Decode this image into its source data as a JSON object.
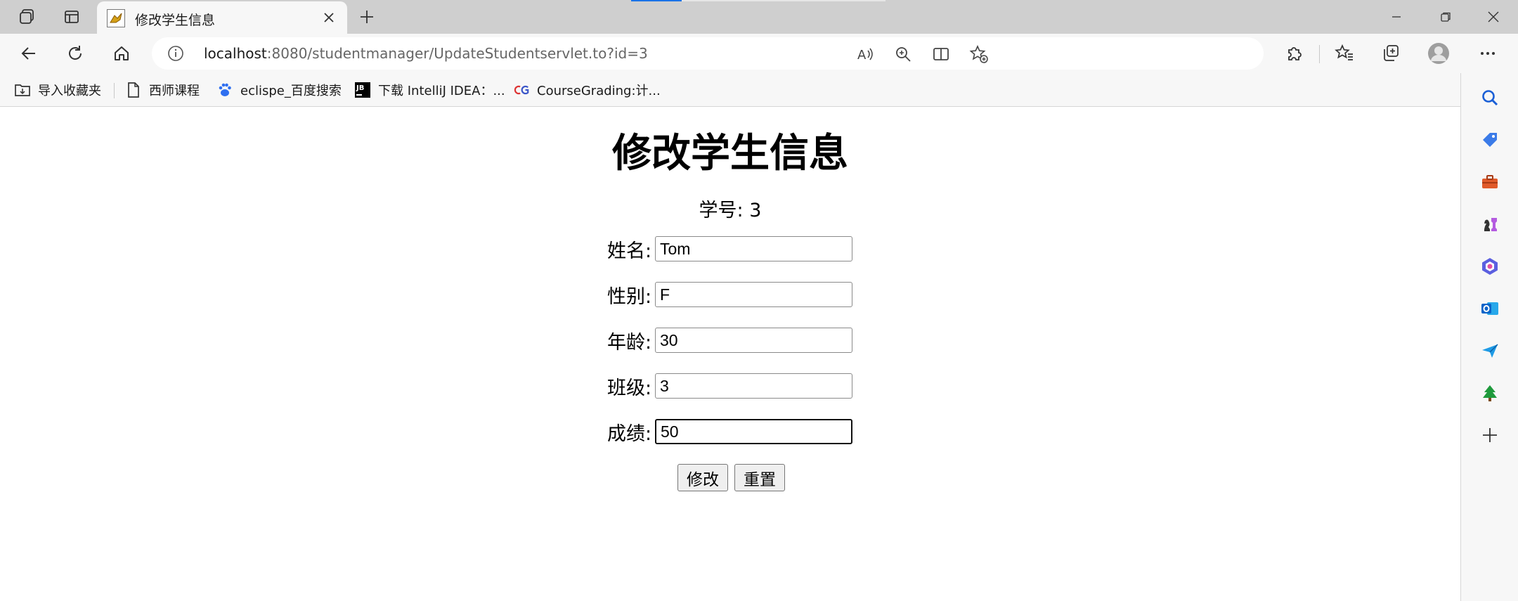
{
  "browser": {
    "tab_title": "修改学生信息",
    "url_host": "localhost",
    "url_rest": ":8080/studentmanager/UpdateStudentservlet.to?id=3",
    "bookmarks": [
      {
        "label": "导入收藏夹",
        "icon": "import-folder-icon"
      },
      {
        "label": "西师课程",
        "icon": "page-icon"
      },
      {
        "label": "eclispe_百度搜索",
        "icon": "baidu-paw-icon"
      },
      {
        "label": "下载 IntelliJ IDEA：...",
        "icon": "jetbrains-icon"
      },
      {
        "label": "CourseGrading:计...",
        "icon": "coursegrading-icon"
      }
    ],
    "sidebar_icons": [
      "search-icon",
      "tag-icon",
      "toolbox-icon",
      "chess-icon",
      "copilot-icon",
      "outlook-icon",
      "send-icon",
      "tree-icon",
      "add-icon"
    ],
    "accent": "#1a73e8"
  },
  "form": {
    "title": "修改学生信息",
    "student_id_label": "学号:",
    "student_id_value": "3",
    "fields": [
      {
        "label": "姓名:",
        "value": "Tom"
      },
      {
        "label": "性别:",
        "value": "F"
      },
      {
        "label": "年龄:",
        "value": "30"
      },
      {
        "label": "班级:",
        "value": "3"
      },
      {
        "label": "成绩:",
        "value": "50"
      }
    ],
    "submit_label": "修改",
    "reset_label": "重置"
  }
}
